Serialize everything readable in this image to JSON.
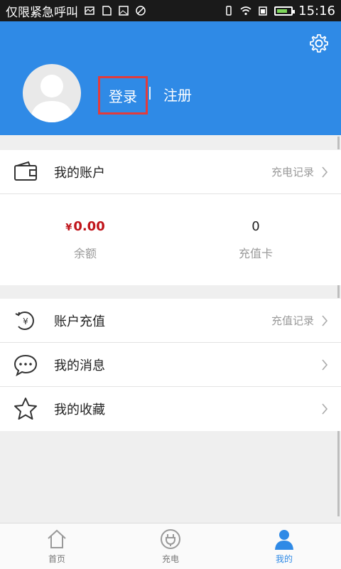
{
  "status_bar": {
    "carrier": "仅限紧急呼叫",
    "time": "15:16"
  },
  "header": {
    "login_label": "登录",
    "separator": "|",
    "register_label": "注册"
  },
  "account": {
    "title": "我的账户",
    "record_link": "充电记录",
    "balance_currency": "¥",
    "balance_value": "0.00",
    "balance_label": "余额",
    "card_value": "0",
    "card_label": "充值卡"
  },
  "menu": [
    {
      "label": "账户充值",
      "right": "充值记录"
    },
    {
      "label": "我的消息",
      "right": ""
    },
    {
      "label": "我的收藏",
      "right": ""
    }
  ],
  "tabs": [
    {
      "label": "首页"
    },
    {
      "label": "充电"
    },
    {
      "label": "我的"
    }
  ],
  "colors": {
    "header_blue": "#2f8ae6",
    "login_highlight": "#e33b3b",
    "balance_red": "#c0141a"
  }
}
